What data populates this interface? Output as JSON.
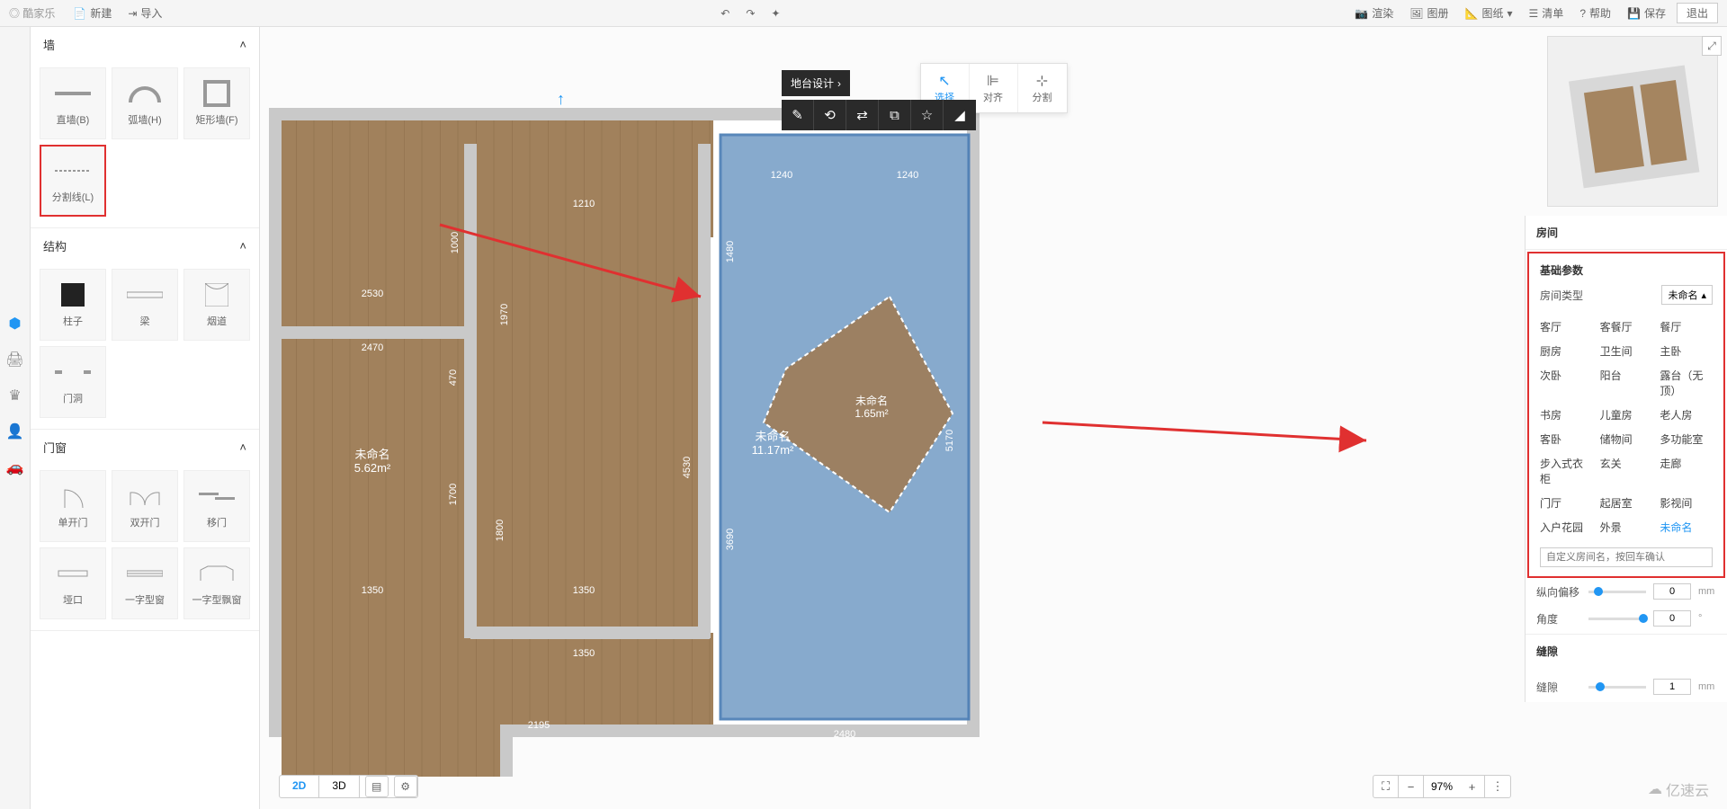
{
  "top": {
    "logo": "酷家乐",
    "new": "新建",
    "import": "导入",
    "undo": "↶",
    "redo": "↷",
    "magic": "✦",
    "render": "渲染",
    "album": "图册",
    "drawing": "图纸",
    "list": "清单",
    "help": "帮助",
    "save": "保存",
    "exit": "退出"
  },
  "left_panel": {
    "sections": {
      "wall": "墙",
      "structure": "结构",
      "door_window": "门窗"
    },
    "wall_items": [
      "直墙(B)",
      "弧墙(H)",
      "矩形墙(F)",
      "分割线(L)"
    ],
    "structure_items": [
      "柱子",
      "梁",
      "烟道",
      "门洞"
    ],
    "dw_items": [
      "单开门",
      "双开门",
      "移门",
      "垭口",
      "一字型窗",
      "一字型飘窗"
    ]
  },
  "tool_group": {
    "select": "选择",
    "align": "对齐",
    "split": "分割"
  },
  "dark_bar": {
    "tag": "地台设计"
  },
  "floor": {
    "rooms": [
      {
        "name": "未命名",
        "area": "5.62m²"
      },
      {
        "name": "未命名",
        "area": "1.65m²"
      },
      {
        "name": "未命名",
        "area": "11.17m²"
      }
    ],
    "dims": [
      "2530",
      "2470",
      "1350",
      "1350",
      "2195",
      "1700",
      "1800",
      "1210",
      "1970",
      "1000",
      "4530",
      "470",
      "1240",
      "1240",
      "1480",
      "5170",
      "3690",
      "2480"
    ]
  },
  "right_panel": {
    "title": "房间",
    "basic_params": "基础参数",
    "room_type_label": "房间类型",
    "room_type_value": "未命名",
    "room_types": [
      "客厅",
      "客餐厅",
      "餐厅",
      "厨房",
      "卫生间",
      "主卧",
      "次卧",
      "阳台",
      "露台（无顶）",
      "书房",
      "儿童房",
      "老人房",
      "客卧",
      "储物间",
      "多功能室",
      "步入式衣柜",
      "玄关",
      "走廊",
      "门厅",
      "起居室",
      "影视间",
      "入户花园",
      "外景",
      "未命名"
    ],
    "custom_placeholder": "自定义房间名，按回车确认",
    "sliders": {
      "vertical_offset": {
        "label": "纵向偏移",
        "value": "0",
        "unit": "mm"
      },
      "angle": {
        "label": "角度",
        "value": "0",
        "unit": "°"
      }
    },
    "gap_section": "缝隙",
    "gap": {
      "label": "缝隙",
      "value": "1",
      "unit": "mm"
    }
  },
  "view": {
    "d2": "2D",
    "d3": "3D"
  },
  "zoom": {
    "value": "97",
    "pct": "%"
  },
  "watermark": "亿速云"
}
